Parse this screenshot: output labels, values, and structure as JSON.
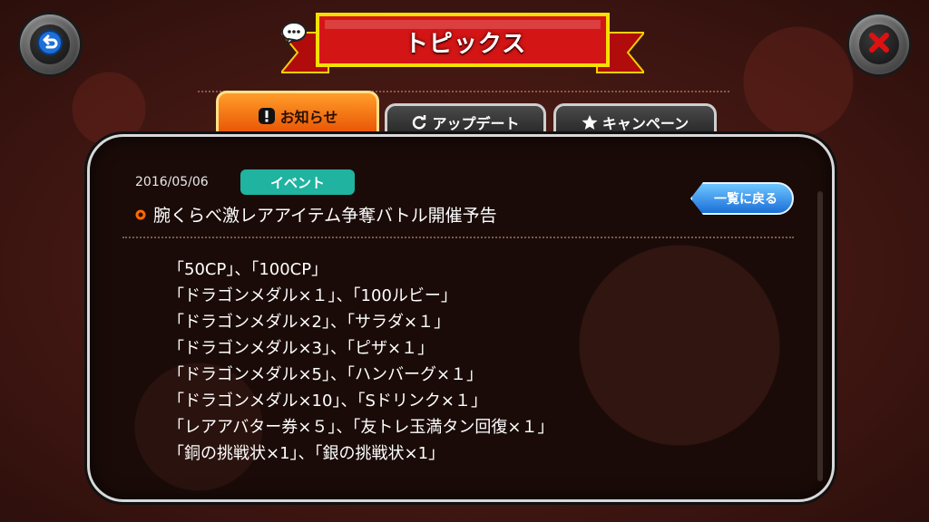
{
  "header": {
    "title": "トピックス",
    "back_icon": "back-arrow-icon",
    "close_icon": "close-x-icon"
  },
  "tabs": [
    {
      "label": "お知らせ",
      "icon": "exclamation-icon",
      "active": true
    },
    {
      "label": "アップデート",
      "icon": "refresh-icon",
      "active": false
    },
    {
      "label": "キャンペーン",
      "icon": "star-icon",
      "active": false
    }
  ],
  "article": {
    "date": "2016/05/06",
    "category": "イベント",
    "title": "腕くらべ激レアアイテム争奪バトル開催予告",
    "back_to_list": "一覧に戻る",
    "lines": [
      "「50CP」、「100CP」",
      "「ドラゴンメダル×１」、「100ルビー」",
      "「ドラゴンメダル×2」、「サラダ×１」",
      "「ドラゴンメダル×3」、「ピザ×１」",
      "「ドラゴンメダル×5」、「ハンバーグ×１」",
      "「ドラゴンメダル×10」、「Sドリンク×１」",
      "「レアアバター券×５」、「友トレ玉満タン回復×１」",
      "「銅の挑戦状×1」、「銀の挑戦状×1」"
    ]
  },
  "colors": {
    "badge": "#1fb3a0",
    "active_tab": "#ff8a1a",
    "banner_red": "#d41515",
    "list_button": "#2a86e8"
  }
}
